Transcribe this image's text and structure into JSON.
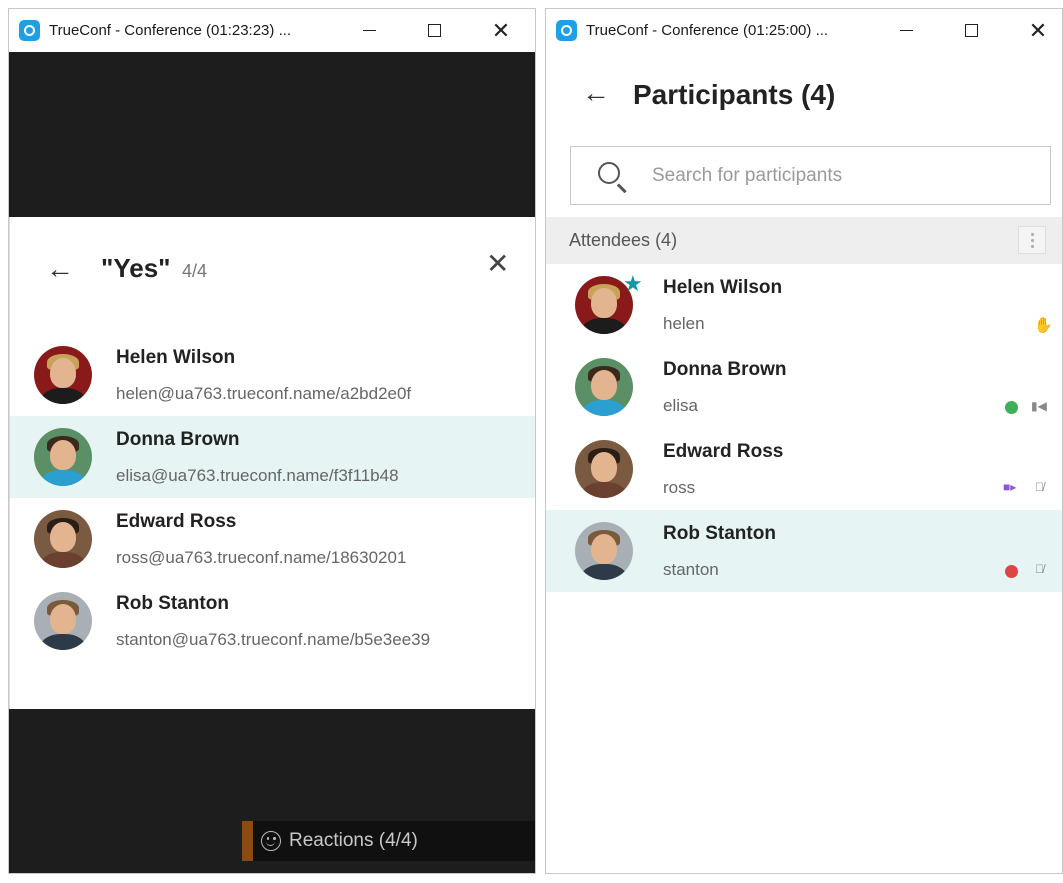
{
  "left_window": {
    "title": "TrueConf - Conference (01:23:23) ...",
    "popup": {
      "title": "\"Yes\"",
      "count": "4/4",
      "participants": [
        {
          "name": "Helen Wilson",
          "address": "helen@ua763.trueconf.name/a2bd2e0f",
          "selected": false
        },
        {
          "name": "Donna Brown",
          "address": "elisa@ua763.trueconf.name/f3f11b48",
          "selected": true
        },
        {
          "name": "Edward Ross",
          "address": "ross@ua763.trueconf.name/18630201",
          "selected": false
        },
        {
          "name": "Rob Stanton",
          "address": "stanton@ua763.trueconf.name/b5e3ee39",
          "selected": false
        }
      ]
    },
    "reactions_label": "Reactions (4/4)"
  },
  "right_window": {
    "title": "TrueConf - Conference (01:25:00) ...",
    "heading": "Participants (4)",
    "search_placeholder": "Search for participants",
    "section_label": "Attendees (4)",
    "participants": [
      {
        "name": "Helen Wilson",
        "login": "helen",
        "status": "hand-raised",
        "owner": true
      },
      {
        "name": "Donna Brown",
        "login": "elisa",
        "status": "green",
        "video": "camera-off"
      },
      {
        "name": "Edward Ross",
        "login": "ross",
        "status": "purple",
        "mic": "muted"
      },
      {
        "name": "Rob Stanton",
        "login": "stanton",
        "status": "red",
        "mic": "muted",
        "selected": true
      }
    ]
  },
  "colors": {
    "accent": "#1596a5",
    "selected_row": "#e6f4f4",
    "reactions_bar": "#8b4a12"
  }
}
